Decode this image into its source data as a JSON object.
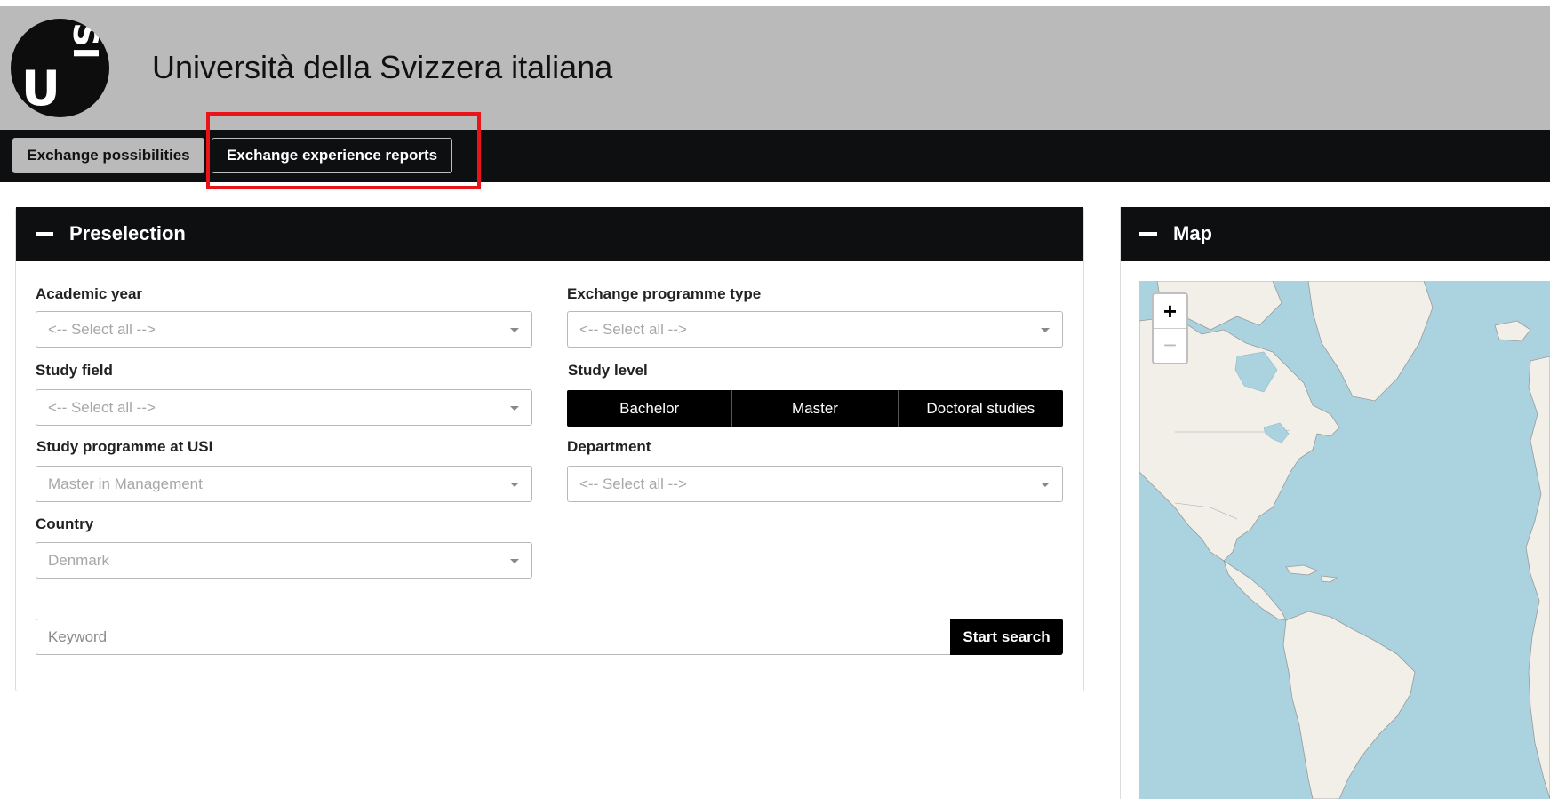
{
  "header": {
    "logo_u": "U",
    "logo_si": "SI",
    "title": "Università della Svizzera italiana"
  },
  "nav": {
    "tabs": [
      {
        "label": "Exchange possibilities",
        "active": true
      },
      {
        "label": "Exchange experience reports",
        "active": false
      }
    ]
  },
  "preselection": {
    "title": "Preselection",
    "academic_year": {
      "label": "Academic year",
      "value": "<-- Select all -->"
    },
    "exchange_programme_type": {
      "label": "Exchange programme type",
      "value": "<-- Select all -->"
    },
    "study_field": {
      "label": "Study field",
      "value": "<-- Select all -->"
    },
    "study_level": {
      "label": "Study level",
      "options": [
        "Bachelor",
        "Master",
        "Doctoral studies"
      ]
    },
    "study_programme": {
      "label": "Study programme at USI",
      "value": "Master in Management"
    },
    "department": {
      "label": "Department",
      "value": "<-- Select all -->"
    },
    "country": {
      "label": "Country",
      "value": "Denmark"
    },
    "keyword": {
      "placeholder": "Keyword"
    },
    "search_button": "Start search"
  },
  "map": {
    "title": "Map",
    "zoom_in": "+",
    "zoom_out": "−"
  },
  "colors": {
    "header_bg": "#bababa",
    "nav_bg": "#0e0f10",
    "highlight": "#e8141a",
    "water": "#aad3df",
    "land": "#f2efe9"
  }
}
